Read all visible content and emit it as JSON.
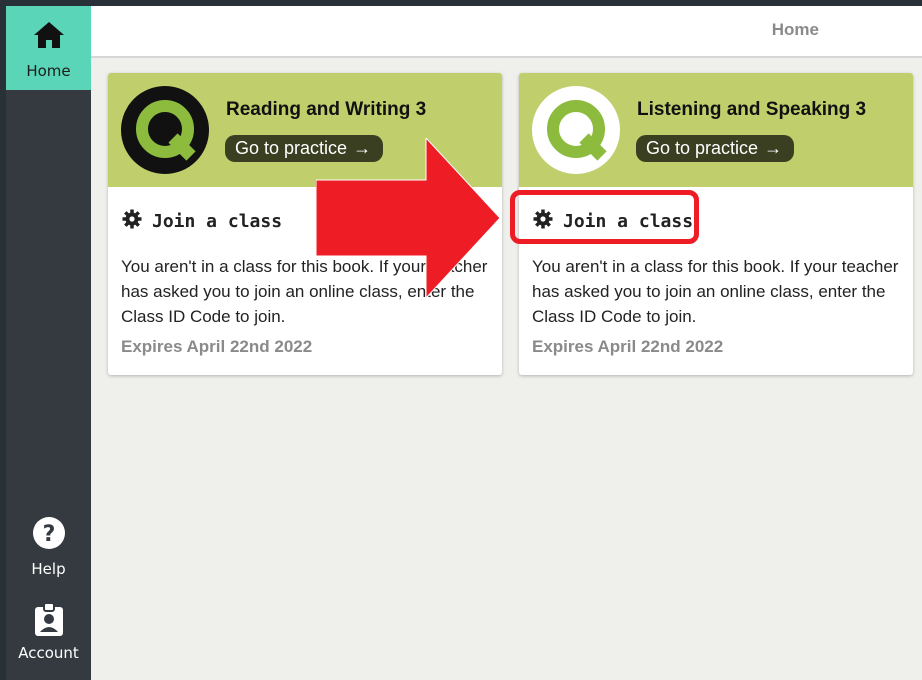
{
  "sidebar": {
    "items": [
      {
        "label": "Home",
        "icon": "home-icon",
        "active": true
      },
      {
        "label": "Help",
        "icon": "help-icon"
      },
      {
        "label": "Account",
        "icon": "account-icon"
      }
    ]
  },
  "header": {
    "breadcrumb": "Home"
  },
  "cards": [
    {
      "title": "Reading and Writing 3",
      "practice_label": "Go to practice",
      "join_label": "Join a class",
      "description": "You aren't in a class for this book. If your teacher has asked you to join an online class, enter the Class ID Code to join.",
      "expires": "Expires April 22nd 2022",
      "logo_style": "dark"
    },
    {
      "title": "Listening and Speaking 3",
      "practice_label": "Go to practice",
      "join_label": "Join a class",
      "description": "You aren't in a class for this book. If your teacher has asked you to join an online class, enter the Class ID Code to join.",
      "expires": "Expires April 22nd 2022",
      "logo_style": "light"
    }
  ],
  "colors": {
    "accent": "#5ad5b8",
    "card_header": "#c0cf6c",
    "annotation": "#ee1c24",
    "sidebar": "#343a40"
  }
}
